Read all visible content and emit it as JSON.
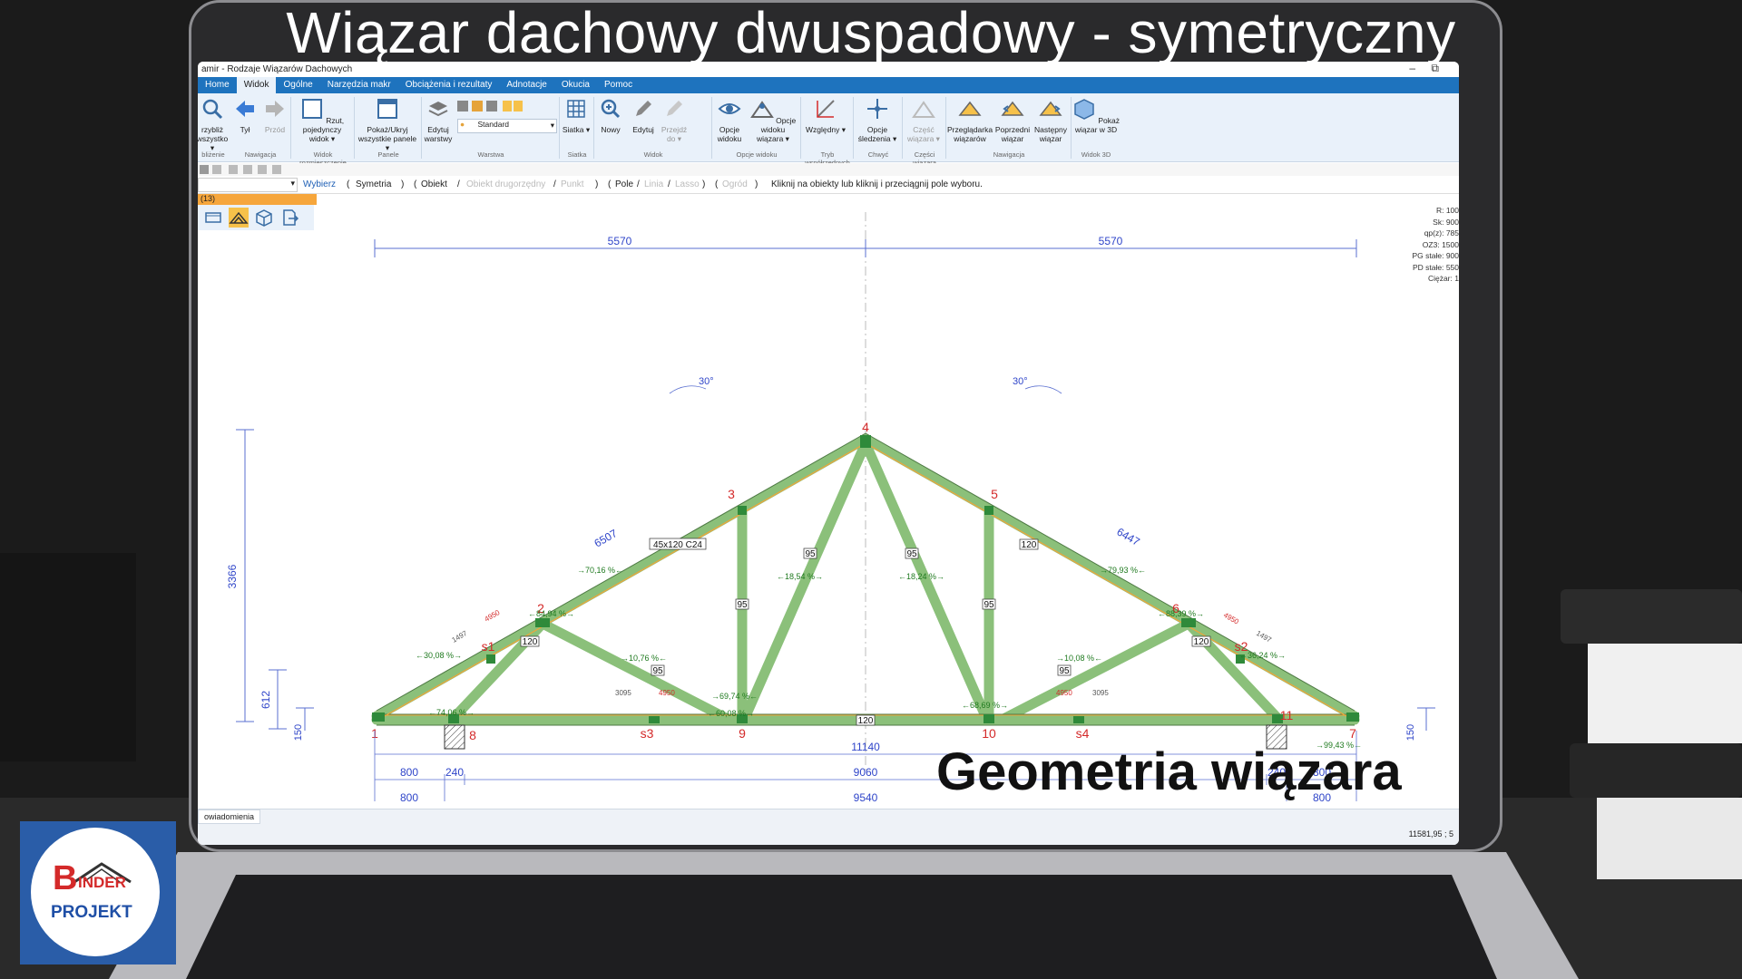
{
  "overlay": {
    "main_title": "Wiązar dachowy dwuspadowy - symetryczny",
    "caption": "Geometria wiązara",
    "logo_letter": "B",
    "logo_text_1": "INDER",
    "logo_text_2": "PROJEKT"
  },
  "window": {
    "title": "amir - Rodzaje Wiązarów Dachowych",
    "minimize": "–",
    "restore": "⧉"
  },
  "tabs": [
    {
      "label": "Home"
    },
    {
      "label": "Widok",
      "active": true
    },
    {
      "label": "Ogólne"
    },
    {
      "label": "Narzędzia makr"
    },
    {
      "label": "Obciążenia i rezultaty"
    },
    {
      "label": "Adnotacje"
    },
    {
      "label": "Okucia"
    },
    {
      "label": "Pomoc"
    }
  ],
  "ribbon": {
    "buttons": {
      "zoom": "rzybliż wszystko ▾",
      "back": "Tył",
      "forward": "Przód",
      "single_view": "Rzut, pojedynczy widok ▾",
      "panels": "Pokaż/Ukryj wszystkie panele ▾",
      "edit_layers": "Edytuj warstwy",
      "layer_select": "Standard",
      "grid": "Siatka ▾",
      "new": "Nowy",
      "edit": "Edytuj",
      "goto": "Przejdź do ▾",
      "view_options": "Opcje widoku",
      "truss_view_options": "Opcje widoku wiązara ▾",
      "relative": "Względny ▾",
      "track_options": "Opcje śledzenia ▾",
      "truss_part": "Część wiązara ▾",
      "truss_browser": "Przeglądarka wiązarów",
      "prev_truss": "Poprzedni wiązar",
      "next_truss": "Następny wiązar",
      "show_3d": "Pokaż wiązar w 3D"
    },
    "groups": {
      "g1": "bliżenie",
      "g2": "Nawigacja",
      "g3": "Widok rozmieszczenie",
      "g4": "Panele",
      "g5": "Warstwa",
      "g6": "Siatka",
      "g7": "Widok",
      "g8": "Opcje widoku",
      "g9": "Tryb współrzędnych",
      "g10": "Chwyć",
      "g11": "Części wiązara",
      "g12": "Nawigacja",
      "g13": "Widok 3D"
    }
  },
  "command_bar": {
    "select": "Wybierz",
    "p1": "(",
    "symmetry": "Symetria",
    "p2": ")",
    "p3": "(",
    "object": "Obiekt",
    "s1": "/",
    "secondary": "Obiekt drugorzędny",
    "s2": "/",
    "point": "Punkt",
    "p4": ")",
    "p5": "(",
    "field": "Pole",
    "s3": "/",
    "lines": "Linia",
    "s4": "/",
    "lasso": "Lasso",
    "p6": ")",
    "p7": "(",
    "fence": "Ogród",
    "p8": ")",
    "hint": "Kliknij na obiekty lub kliknij i przeciągnij pole wyboru."
  },
  "panel": {
    "head": "(13)"
  },
  "props": [
    {
      "k": "R:",
      "v": "100"
    },
    {
      "k": "Sk:",
      "v": "900"
    },
    {
      "k": "qp(z):",
      "v": "785"
    },
    {
      "k": "OZ3:",
      "v": "1500"
    },
    {
      "k": "PG stałe:",
      "v": "900"
    },
    {
      "k": "PD stałe:",
      "v": "550"
    },
    {
      "k": "Ciężar:",
      "v": "1"
    }
  ],
  "drawing": {
    "top_dims": [
      "5570",
      "5570"
    ],
    "angles": [
      "30°",
      "30°"
    ],
    "rafter_lengths": [
      "6507",
      "6447"
    ],
    "height_dims": [
      "3366",
      "612",
      "150",
      "150"
    ],
    "node_labels": [
      "1",
      "2",
      "3",
      "4",
      "5",
      "6",
      "7",
      "8",
      "9",
      "10",
      "s1",
      "s2",
      "s3",
      "s4",
      "11"
    ],
    "member_labels": [
      "45x120 C24",
      "95",
      "95",
      "95",
      "95",
      "120",
      "120",
      "120",
      "95",
      "95",
      "120"
    ],
    "utilizations": [
      "→70,16 %←",
      "←84,94 %→",
      "←30,08 %→",
      "←74,06 %→",
      "←18,54 %→",
      "←18,24 %→",
      "→79,93 %←",
      "←88,39 %→",
      "←36,24 %→",
      "→10,76 %←",
      "→10,08 %←",
      "→69,74 %←",
      "←60,08 %→",
      "←68,69 %→",
      "→99,43 %←"
    ],
    "dims_small": [
      "3095",
      "4950",
      "4950",
      "3095",
      "1497",
      "4950",
      "4950",
      "1497"
    ],
    "bottom_dims": {
      "row1": "11140",
      "row2": [
        "800",
        "240",
        "9060",
        "240",
        "800"
      ],
      "row3": [
        "800",
        "9540",
        "800"
      ]
    }
  },
  "status": {
    "tab": "owiadomienia",
    "coords": "11581,95 ; 5"
  }
}
